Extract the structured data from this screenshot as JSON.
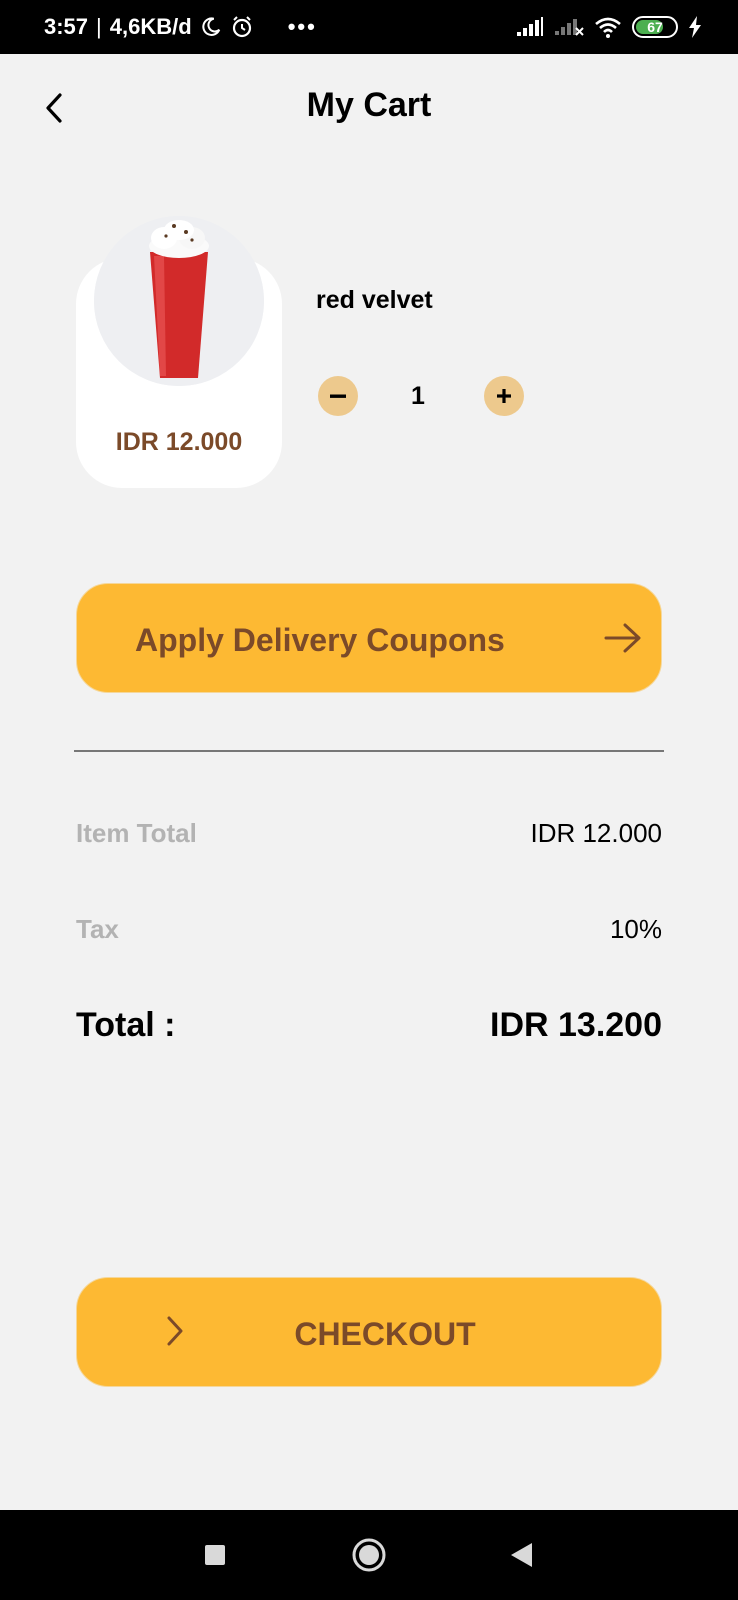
{
  "status_bar": {
    "time": "3:57",
    "separator": "|",
    "network_speed": "4,6KB/d",
    "more": "•••",
    "battery_level": "67",
    "icons": [
      "moon-icon",
      "alarm-icon",
      "signal-icon",
      "signal-off-icon",
      "wifi-icon",
      "battery-icon",
      "charging-icon"
    ]
  },
  "header": {
    "title": "My Cart",
    "back_icon": "chevron-left-icon"
  },
  "cart": {
    "items": [
      {
        "name": "red velvet",
        "price": "IDR 12.000",
        "quantity": "1",
        "minus_symbol": "−",
        "plus_symbol": "+"
      }
    ]
  },
  "coupon": {
    "label": "Apply Delivery Coupons",
    "icon": "arrow-right-icon"
  },
  "summary": {
    "item_total_label": "Item Total",
    "item_total_value": "IDR 12.000",
    "tax_label": "Tax",
    "tax_value": "10%",
    "total_label": "Total :",
    "total_value": "IDR 13.200"
  },
  "checkout": {
    "label": "CHECKOUT",
    "icon": "chevron-right-icon"
  },
  "nav_bar": {
    "icons": [
      "recents-icon",
      "home-icon",
      "back-icon"
    ]
  },
  "colors": {
    "accent": "#fdb933",
    "accent_text": "#7b4a29",
    "qty_button": "#edc98d",
    "background": "#f2f2f2",
    "muted_text": "#b3b3b3"
  }
}
